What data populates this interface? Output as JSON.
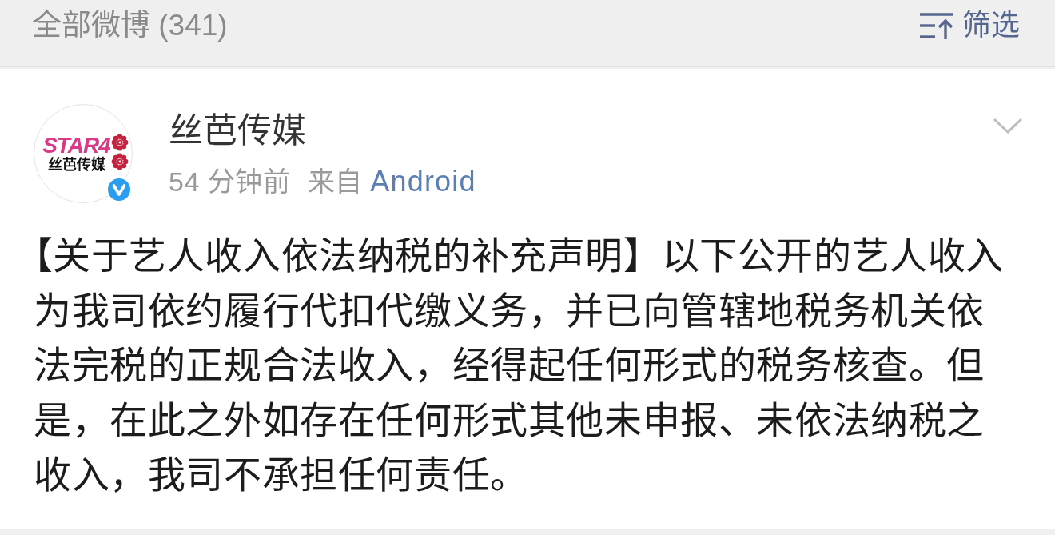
{
  "header": {
    "title": "全部微博 (341)",
    "filter_label": "筛选"
  },
  "post": {
    "author": {
      "name": "丝芭传媒",
      "verified": true,
      "avatar": {
        "wordmark": "STAR4",
        "caption": "丝芭传媒"
      }
    },
    "time": "54 分钟前",
    "source_prefix": "来自",
    "source": "Android",
    "text": "【关于艺人收入依法纳税的补充声明】以下公开的艺人收入为我司依约履行代扣代缴义务，并已向管辖地税务机关依法完税的正规合法收入，经得起任何形式的税务核查。但是，在此之外如存在任何形式其他未申报、未依法纳税之收入，我司不承担任何责任。"
  }
}
